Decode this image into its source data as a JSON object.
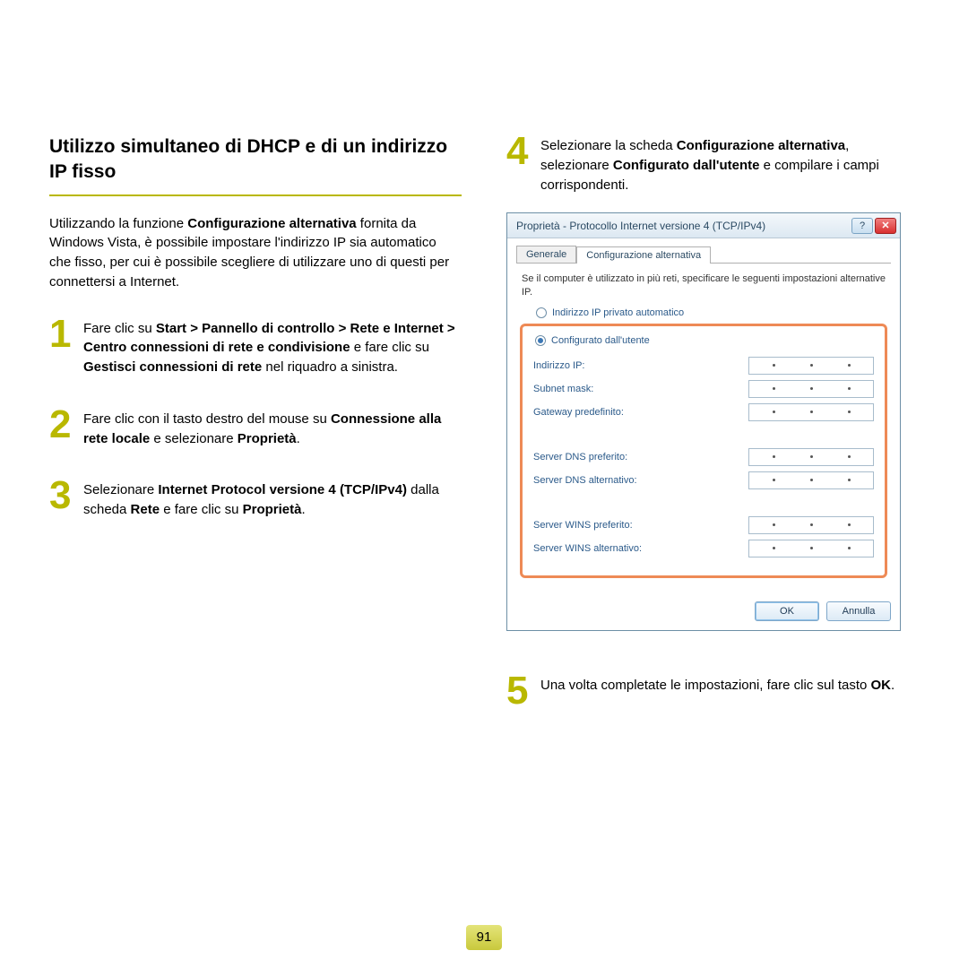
{
  "heading": "Utilizzo simultaneo di DHCP e di un indirizzo IP fisso",
  "intro_parts": [
    "Utilizzando la funzione ",
    "Configurazione alternativa",
    " fornita da Windows Vista, è possibile impostare l'indirizzo IP sia automatico che fisso, per cui è possibile scegliere di utilizzare uno di questi per connettersi a Internet."
  ],
  "steps": {
    "s1": {
      "num": "1",
      "parts": [
        "Fare clic su ",
        "Start > Pannello di controllo > Rete e Internet > Centro connessioni di rete e condivisione",
        " e fare clic su ",
        "Gestisci connessioni di rete",
        " nel riquadro a sinistra."
      ]
    },
    "s2": {
      "num": "2",
      "parts": [
        "Fare clic con il tasto destro del mouse su ",
        "Connessione alla rete locale",
        " e selezionare ",
        "Proprietà",
        "."
      ]
    },
    "s3": {
      "num": "3",
      "parts": [
        "Selezionare ",
        "Internet Protocol versione 4 (TCP/IPv4)",
        " dalla scheda ",
        "Rete",
        " e fare clic su ",
        "Proprietà",
        "."
      ]
    },
    "s4": {
      "num": "4",
      "parts": [
        "Selezionare la scheda ",
        "Configurazione alternativa",
        ", selezionare ",
        "Configurato dall'utente",
        " e compilare i campi corrispondenti."
      ]
    },
    "s5": {
      "num": "5",
      "parts": [
        "Una volta completate le impostazioni, fare clic sul tasto ",
        "OK",
        "."
      ]
    }
  },
  "dialog": {
    "title": "Proprietà - Protocollo Internet versione 4 (TCP/IPv4)",
    "help_glyph": "?",
    "close_glyph": "✕",
    "tabs": {
      "general": "Generale",
      "alt": "Configurazione alternativa"
    },
    "desc": "Se il computer è utilizzato in più reti, specificare le seguenti impostazioni alternative IP.",
    "radio_auto": "Indirizzo IP privato automatico",
    "radio_user": "Configurato dall'utente",
    "fields": {
      "ip": "Indirizzo IP:",
      "mask": "Subnet mask:",
      "gw": "Gateway predefinito:",
      "dns1": "Server DNS preferito:",
      "dns2": "Server DNS alternativo:",
      "wins1": "Server WINS preferito:",
      "wins2": "Server WINS alternativo:"
    },
    "ok": "OK",
    "cancel": "Annulla"
  },
  "page_number": "91"
}
